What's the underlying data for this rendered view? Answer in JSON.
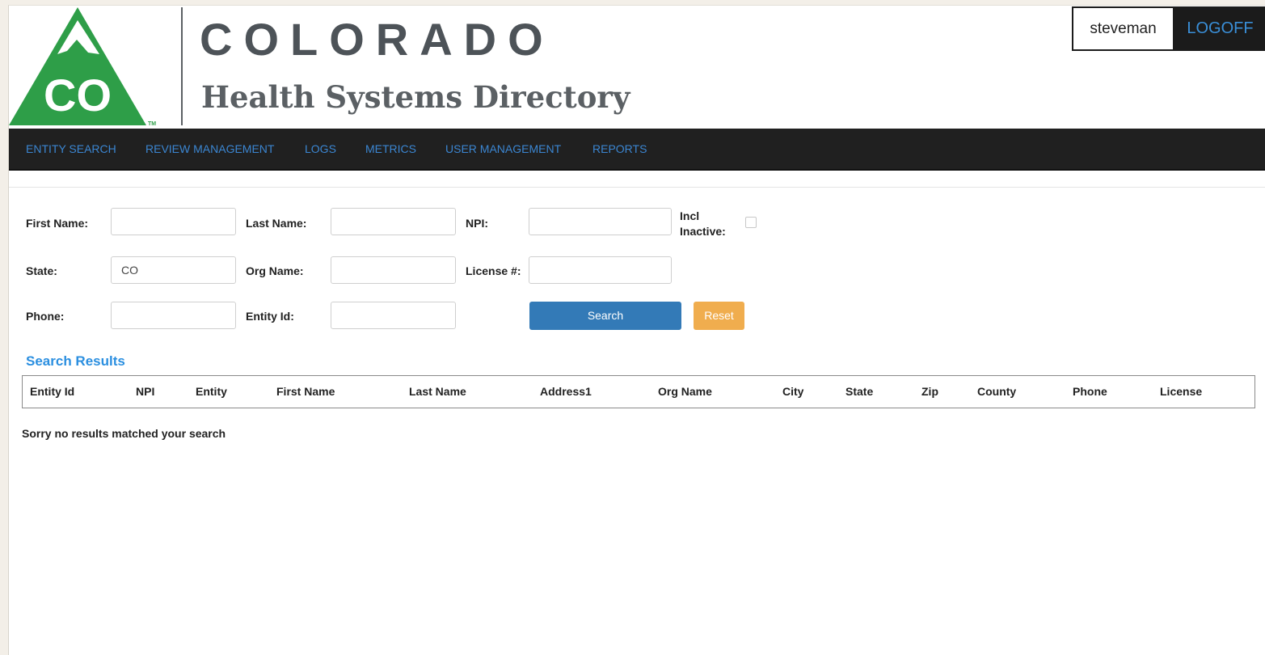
{
  "header": {
    "title": "COLORADO",
    "subtitle": "Health Systems Directory",
    "logo_text": "CO",
    "logo_tm": "TM",
    "brand_color": "#2e9e48",
    "username": "steveman",
    "logoff_label": "LOGOFF"
  },
  "nav": {
    "items": [
      {
        "label": "ENTITY SEARCH"
      },
      {
        "label": "REVIEW MANAGEMENT"
      },
      {
        "label": "LOGS"
      },
      {
        "label": "METRICS"
      },
      {
        "label": "USER MANAGEMENT"
      },
      {
        "label": "REPORTS"
      }
    ],
    "link_color": "#3b86d2"
  },
  "form": {
    "first_name": {
      "label": "First Name:",
      "value": ""
    },
    "last_name": {
      "label": "Last Name:",
      "value": ""
    },
    "npi": {
      "label": "NPI:",
      "value": ""
    },
    "incl_inactive": {
      "label": "Incl Inactive:",
      "checked": false
    },
    "state": {
      "label": "State:",
      "value": "CO"
    },
    "org_name": {
      "label": "Org Name:",
      "value": ""
    },
    "license": {
      "label": "License #:",
      "value": ""
    },
    "phone": {
      "label": "Phone:",
      "value": ""
    },
    "entity_id": {
      "label": "Entity Id:",
      "value": ""
    },
    "search_label": "Search",
    "reset_label": "Reset"
  },
  "results": {
    "heading": "Search Results",
    "columns": [
      "Entity Id",
      "NPI",
      "Entity",
      "First Name",
      "Last Name",
      "Address1",
      "Org Name",
      "City",
      "State",
      "Zip",
      "County",
      "Phone",
      "License"
    ],
    "empty_message": "Sorry no results matched your search"
  }
}
